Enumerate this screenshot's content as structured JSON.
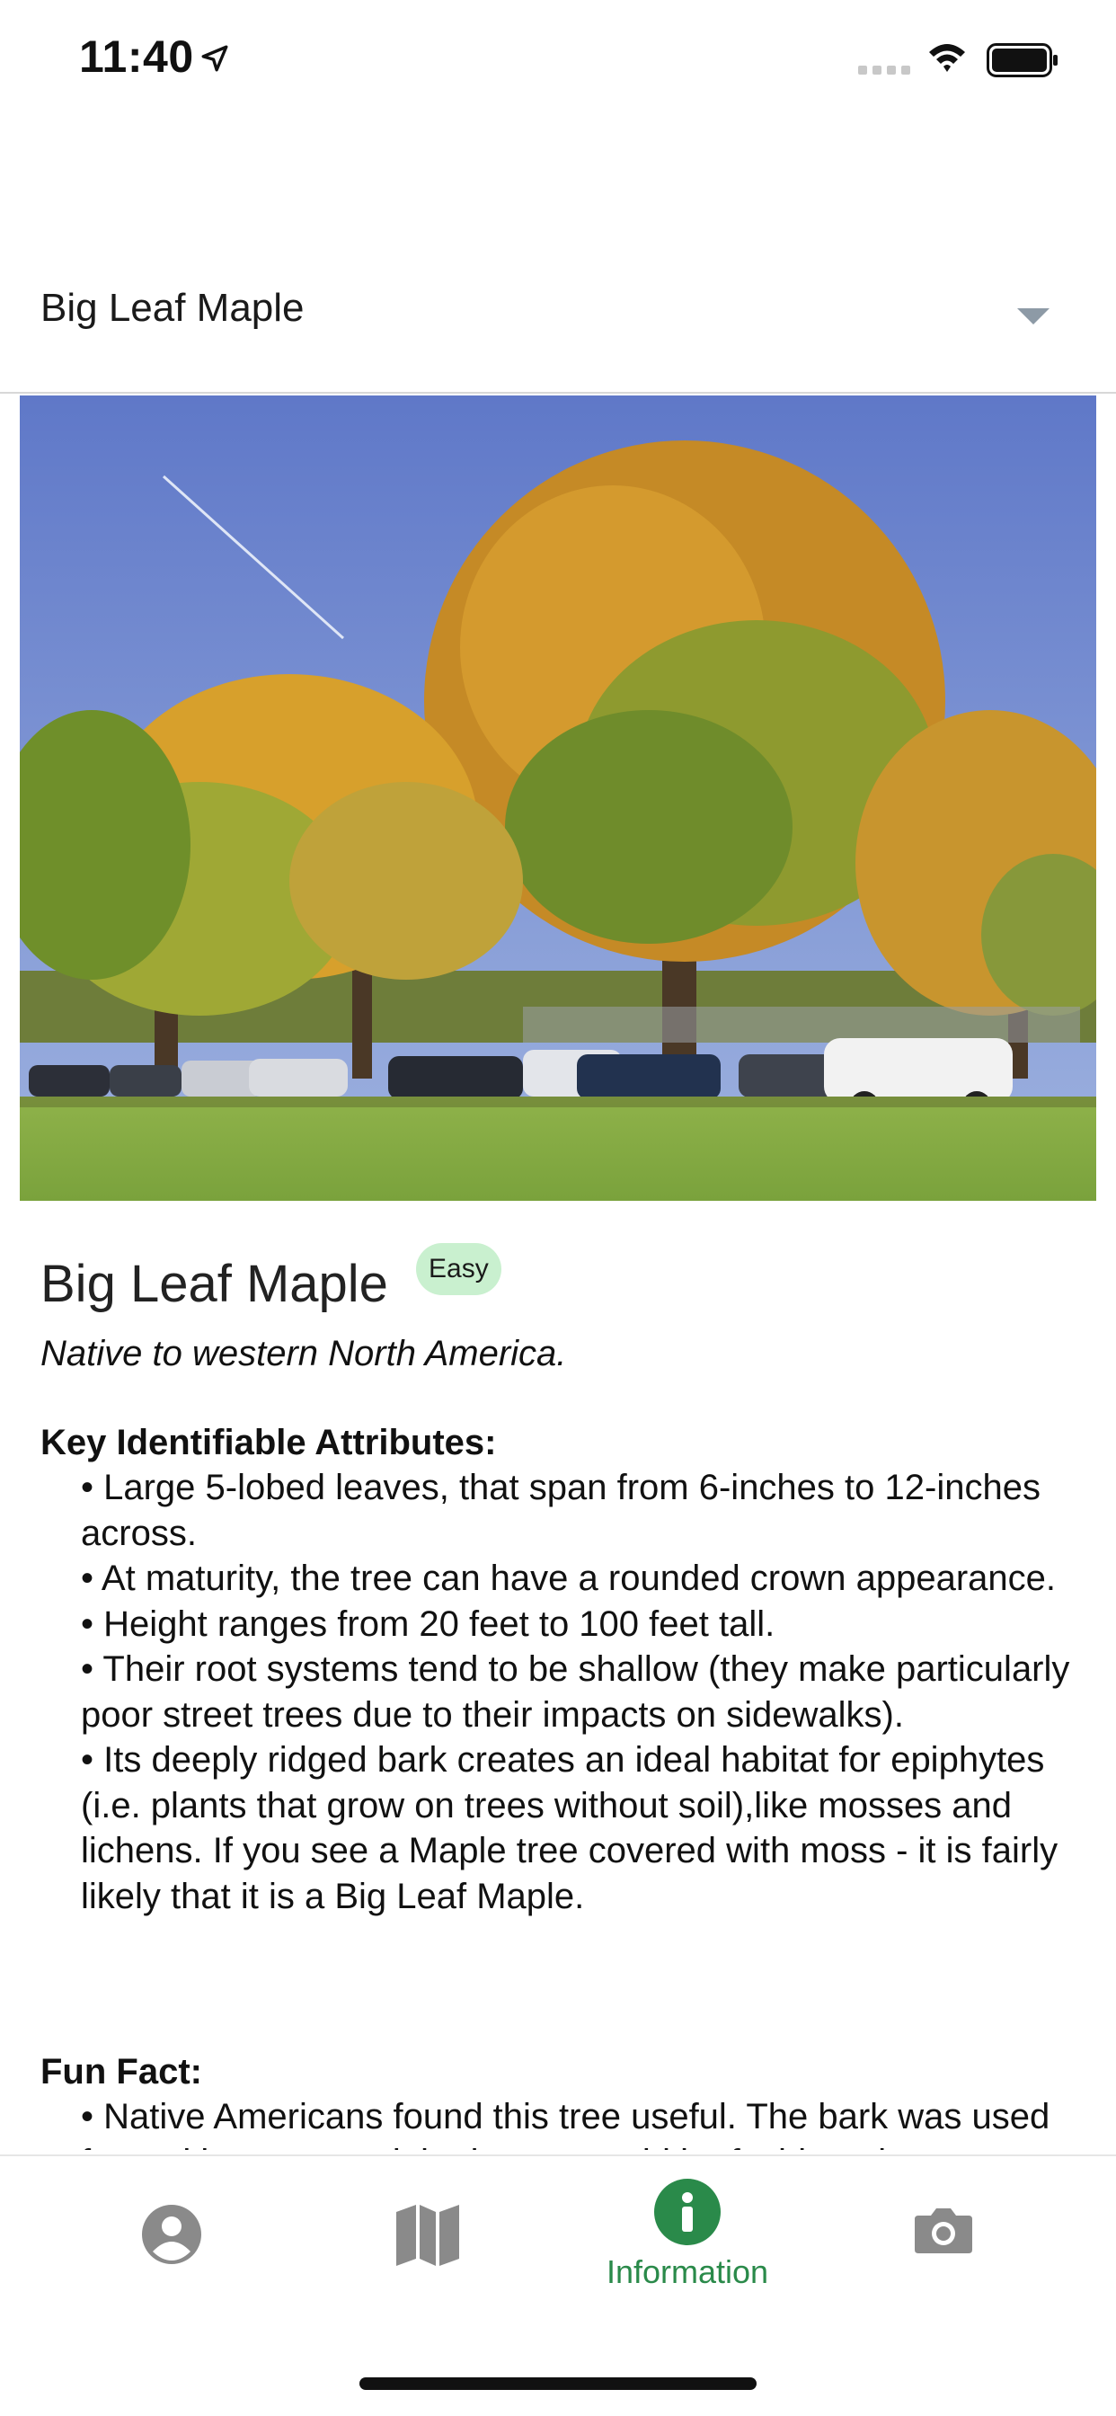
{
  "status_bar": {
    "time": "11:40",
    "icons": [
      "location-arrow-icon",
      "signal-icon",
      "wifi-icon",
      "battery-icon"
    ]
  },
  "dropdown": {
    "selected": "Big Leaf Maple",
    "icon": "chevron-down-icon"
  },
  "species": {
    "title": "Big Leaf Maple",
    "difficulty": "Easy",
    "origin": "Native to western North America."
  },
  "attributes": {
    "heading": "Key Identifiable Attributes:",
    "items": [
      "• Large 5-lobed leaves, that span from 6-inches to 12-inches across.",
      "• At maturity, the tree can have a rounded crown appearance.",
      "• Height ranges from 20 feet to 100 feet tall.",
      "• Their root systems tend to be shallow (they make particularly poor street trees due to their impacts on sidewalks).",
      "• Its deeply ridged bark creates an ideal habitat for epiphytes (i.e. plants that grow on trees without soil),like mosses and lichens. If you see a Maple tree covered with moss - it is fairly likely that it is a Big Leaf Maple."
    ]
  },
  "fun_fact": {
    "heading": "Fun Fact:",
    "items": [
      "• Native Americans found this tree useful. The bark was used for making rope and the leaves could be fashioned"
    ]
  },
  "tab_bar": {
    "tabs": [
      {
        "icon": "person-icon",
        "label": "",
        "active": false
      },
      {
        "icon": "map-icon",
        "label": "",
        "active": false
      },
      {
        "icon": "info-icon",
        "label": "Information",
        "active": true
      },
      {
        "icon": "camera-icon",
        "label": "",
        "active": false
      }
    ]
  },
  "colors": {
    "accent": "#2a8a4a",
    "badge_bg": "#c9f0cf",
    "inactive_icon": "#8a8a8a",
    "divider": "#d8d8d8"
  }
}
